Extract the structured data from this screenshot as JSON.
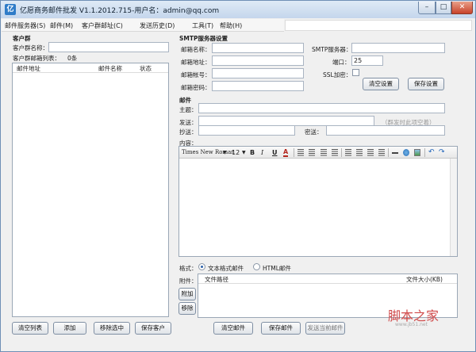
{
  "window": {
    "title": "亿愿商务邮件批发 V1.1.2012.715-用户名：admin@qq.com",
    "minimize": "–",
    "maximize": "□",
    "close": "✕"
  },
  "menu": {
    "items": [
      "邮件服务器(S)",
      "邮件(M)",
      "客户群邮址(C)",
      "发送历史(D)",
      "工具(T)",
      "帮助(H)"
    ]
  },
  "customer_group": {
    "section_title": "客户群",
    "name_label": "客户群名称：",
    "name_value": "",
    "list_label": "客户群邮箱列表：",
    "list_count": "0条",
    "columns": [
      "邮件地址",
      "邮件名称",
      "状态"
    ],
    "buttons": {
      "clear": "清空列表",
      "add": "添加",
      "remove": "移除选中",
      "save": "保存客户"
    }
  },
  "smtp": {
    "section_title": "SMTP服务器设置",
    "fields": {
      "mailbox_name": {
        "label": "邮箱名称：",
        "value": ""
      },
      "mailbox_address": {
        "label": "邮箱地址：",
        "value": ""
      },
      "mailbox_account": {
        "label": "邮箱帐号：",
        "value": ""
      },
      "mailbox_password": {
        "label": "邮箱密码：",
        "value": ""
      },
      "smtp_server": {
        "label": "SMTP服务器：",
        "value": ""
      },
      "port": {
        "label": "端口：",
        "value": "25"
      }
    },
    "ssl_label": "SSL加密：",
    "ssl_checked": false,
    "buttons": {
      "clear": "清空设置",
      "save": "保存设置"
    }
  },
  "mail": {
    "section_title": "邮件",
    "subject_label": "主题：",
    "subject_value": "",
    "send_label": "发送：",
    "send_value": "",
    "send_placeholder": "（群发时此项空着）",
    "cc_label": "抄送：",
    "cc_value": "",
    "bcc_label": "密送：",
    "bcc_value": "",
    "content_label": "内容：",
    "editor": {
      "font_name": "Times New Roman",
      "font_size": "12",
      "bold": "B",
      "italic": "I",
      "underline": "U",
      "font_color": "A"
    },
    "format_label": "格式：",
    "format_options": [
      "文本格式邮件",
      "HTML邮件"
    ],
    "format_selected": "文本格式邮件",
    "attachment_label": "附件：",
    "attachment_columns": [
      "文件路径",
      "文件大小(KB)"
    ],
    "attach_button": "附加",
    "remove_attach_button": "移除",
    "buttons": {
      "clear": "清空邮件",
      "save": "保存邮件",
      "send": "发送当前邮件"
    }
  },
  "watermark": {
    "text": "脚本之家",
    "url": "www.jb51.net"
  }
}
